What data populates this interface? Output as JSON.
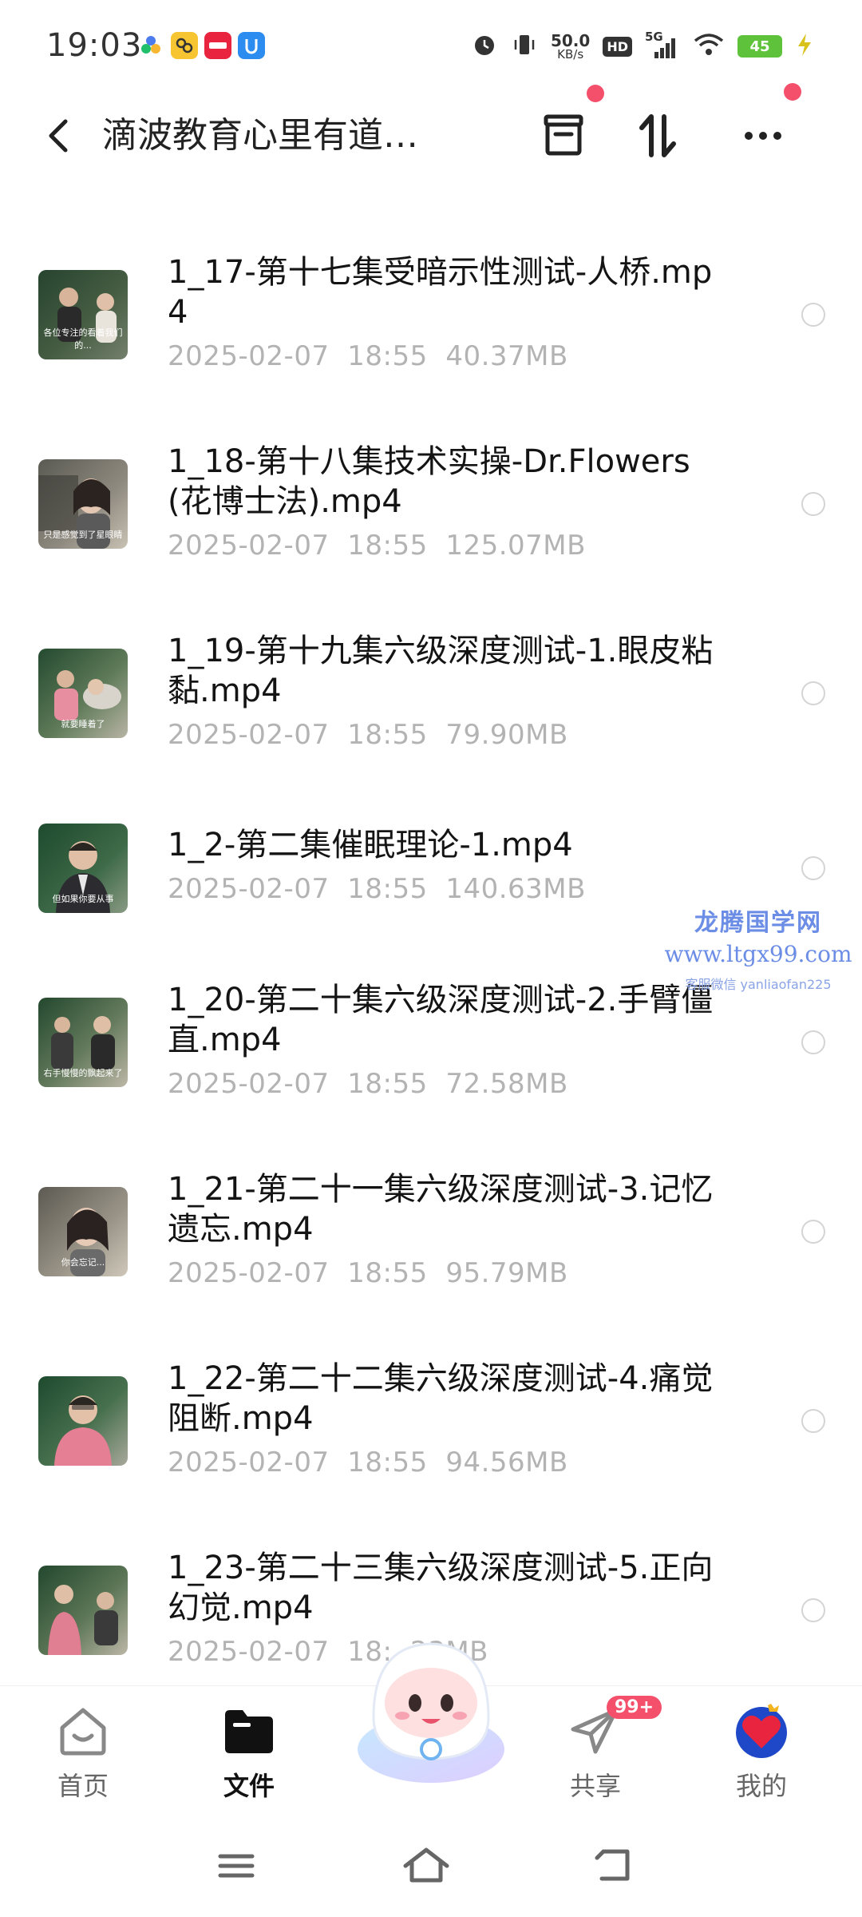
{
  "status_bar": {
    "time": "19:03",
    "net_speed_value": "50.0",
    "net_speed_unit": "KB/s",
    "hd_label": "HD",
    "network_label": "5G",
    "battery_level": "45"
  },
  "header": {
    "title": "滴波教育心里有道…",
    "back_icon": "chevron-left-icon",
    "actions": [
      "archive-icon",
      "sort-icon",
      "more-icon"
    ]
  },
  "files": [
    {
      "name": "1_17-第十七集受暗示性测试-人桥.mp4",
      "date": "2025-02-07",
      "time": "18:55",
      "size": "40.37MB",
      "thumb_caption": "各位专注的看着我们的..."
    },
    {
      "name": "1_18-第十八集技术实操-Dr.Flowers(花博士法).mp4",
      "date": "2025-02-07",
      "time": "18:55",
      "size": "125.07MB",
      "thumb_caption": "只是感觉到了星眼睛"
    },
    {
      "name": "1_19-第十九集六级深度测试-1.眼皮粘黏.mp4",
      "date": "2025-02-07",
      "time": "18:55",
      "size": "79.90MB",
      "thumb_caption": "就要睡着了"
    },
    {
      "name": "1_2-第二集催眠理论-1.mp4",
      "date": "2025-02-07",
      "time": "18:55",
      "size": "140.63MB",
      "thumb_caption": "但如果你要从事"
    },
    {
      "name": "1_20-第二十集六级深度测试-2.手臂僵直.mp4",
      "date": "2025-02-07",
      "time": "18:55",
      "size": "72.58MB",
      "thumb_caption": "右手慢慢的飘起来了"
    },
    {
      "name": "1_21-第二十一集六级深度测试-3.记忆遗忘.mp4",
      "date": "2025-02-07",
      "time": "18:55",
      "size": "95.79MB",
      "thumb_caption": "你会忘记..."
    },
    {
      "name": "1_22-第二十二集六级深度测试-4.痛觉阻断.mp4",
      "date": "2025-02-07",
      "time": "18:55",
      "size": "94.56MB",
      "thumb_caption": ""
    },
    {
      "name": "1_23-第二十三集六级深度测试-5.正向幻觉.mp4",
      "date": "2025-02-07",
      "time": "18:",
      "size": "23MB",
      "thumb_caption": ""
    }
  ],
  "watermark": {
    "title": "龙腾国学网",
    "url": "www.ltgx99.com",
    "contact": "客服微信 yanliaofan225"
  },
  "bottom_nav": {
    "items": [
      {
        "label": "首页",
        "icon": "home-icon",
        "active": false
      },
      {
        "label": "文件",
        "icon": "folder-icon",
        "active": true
      },
      {
        "label": "共享",
        "icon": "paper-plane-icon",
        "active": false,
        "badge": "99+"
      },
      {
        "label": "我的",
        "icon": "heart-avatar-icon",
        "active": false
      }
    ]
  },
  "colors": {
    "accent_red": "#f4506c",
    "meta_gray": "#b3b3b3",
    "watermark_blue": "#6b8de5"
  }
}
